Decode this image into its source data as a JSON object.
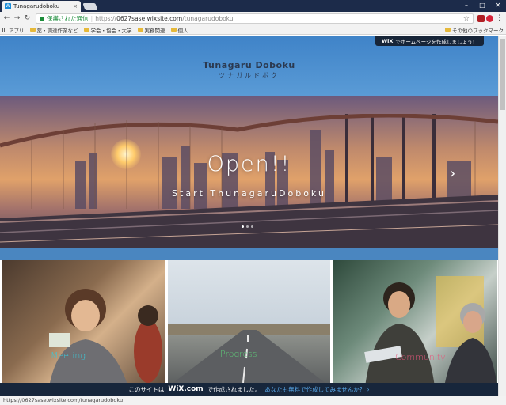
{
  "browser": {
    "tab_title": "Tunagarudoboku",
    "tab_close": "×",
    "secure_label": "保護された通信",
    "url_scheme": "https://",
    "url_host": "0627sase.wixsite.com",
    "url_path": "/tunagarudoboku",
    "bookmarks": [
      "アプリ",
      "薬・調達作業など",
      "学会・協会・大学",
      "実務関連",
      "個人"
    ],
    "bookmarks_other": "その他のブックマーク",
    "status_url": "https://0627sase.wixsite.com/tunagarudoboku"
  },
  "site": {
    "wix_banner_logo": "WiX",
    "wix_banner_text": "でホームページを作成しましょう！",
    "title": "Tunagaru Doboku",
    "subtitle": "ツナガルドボク",
    "hero_title": "Open!!",
    "hero_subtitle": "Start ThunagaruDoboku",
    "cards": [
      {
        "label": "Meeting"
      },
      {
        "label": "Progress"
      },
      {
        "label": "Community"
      }
    ],
    "footer_text_1": "このサイトは",
    "footer_logo": "WiX.com",
    "footer_text_2": "で作成されました。",
    "footer_cta": "あなたも無料で作成してみませんか？ ›"
  },
  "colors": {
    "header_blue": "#4a8ccc",
    "wix_dark": "#17263b",
    "secure_green": "#1b8c3a"
  }
}
